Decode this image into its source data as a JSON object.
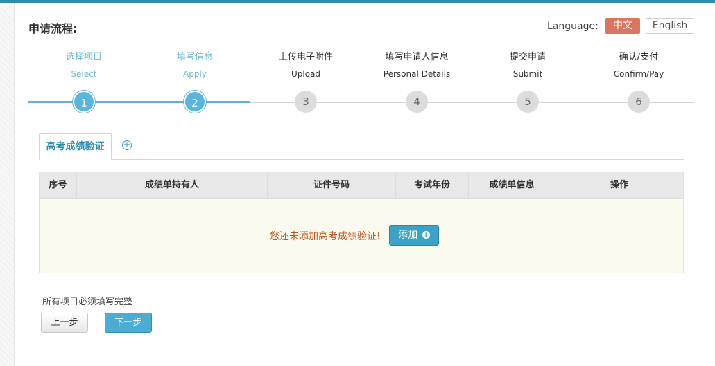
{
  "header": {
    "title": "申请流程:",
    "language_label": "Language:",
    "languages": [
      "中文",
      "English"
    ]
  },
  "steps": [
    {
      "number": "1",
      "zh": "选择项目",
      "en": "Select",
      "state": "done"
    },
    {
      "number": "2",
      "zh": "填写信息",
      "en": "Apply",
      "state": "done"
    },
    {
      "number": "3",
      "zh": "上传电子附件",
      "en": "Upload",
      "state": "todo"
    },
    {
      "number": "4",
      "zh": "填写申请人信息",
      "en": "Personal Details",
      "state": "todo"
    },
    {
      "number": "5",
      "zh": "提交申请",
      "en": "Submit",
      "state": "todo"
    },
    {
      "number": "6",
      "zh": "确认/支付",
      "en": "Confirm/Pay",
      "state": "todo"
    }
  ],
  "tabs": {
    "active_label": "高考成绩验证",
    "add_icon": "plus-circle-icon"
  },
  "table": {
    "headers": [
      "序号",
      "成绩单持有人",
      "证件号码",
      "考试年份",
      "成绩单信息",
      "操作"
    ],
    "empty_message": "您还未添加高考成绩验证!",
    "add_label": "添加"
  },
  "footer": {
    "hint": "所有项目必须填写完整",
    "prev_label": "上一步",
    "next_label": "下一步"
  },
  "colors": {
    "accent": "#2f8fa8",
    "active_step": "#58b5dc",
    "language_active": "#d9765f",
    "warning_text": "#c6541b"
  }
}
